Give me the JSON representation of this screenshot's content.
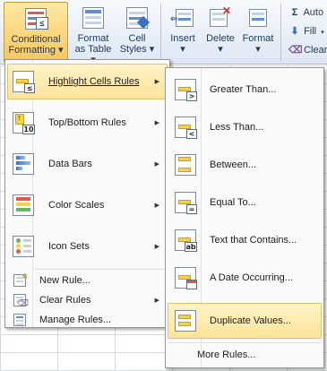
{
  "ribbon": {
    "conditional_formatting": {
      "line1": "Conditional",
      "line2": "Formatting",
      "icon": "conditional-formatting-icon"
    },
    "format_as_table": {
      "line1": "Format",
      "line2": "as Table",
      "icon": "format-as-table-icon"
    },
    "cell_styles": {
      "line1": "Cell",
      "line2": "Styles",
      "icon": "cell-styles-icon"
    },
    "insert": {
      "label": "Insert",
      "icon": "insert-cells-icon"
    },
    "delete": {
      "label": "Delete",
      "icon": "delete-cells-icon"
    },
    "format": {
      "label": "Format",
      "icon": "format-cells-icon"
    },
    "autosum": {
      "glyph": "Σ",
      "label": "Auto"
    },
    "fill": {
      "glyph": "⬇",
      "label": "Fill"
    },
    "clear": {
      "glyph": "⌫",
      "label": "Clear"
    },
    "dropdown_glyph": "▾"
  },
  "main_menu": {
    "items": [
      {
        "label": "Highlight Cells Rules",
        "hotkey_index": 0,
        "icon": "highlight-cells-rules-icon",
        "submenu": true,
        "highlighted": true
      },
      {
        "label": "Top/Bottom Rules",
        "icon": "top-bottom-rules-icon",
        "submenu": true
      },
      {
        "label": "Data Bars",
        "icon": "data-bars-icon",
        "submenu": true
      },
      {
        "label": "Color Scales",
        "icon": "color-scales-icon",
        "submenu": true
      },
      {
        "label": "Icon Sets",
        "icon": "icon-sets-icon",
        "submenu": true
      },
      {
        "label": "New Rule...",
        "icon": "new-rule-icon",
        "submenu": false
      },
      {
        "label": "Clear Rules",
        "icon": "clear-rules-icon",
        "submenu": true
      },
      {
        "label": "Manage Rules...",
        "icon": "manage-rules-icon",
        "submenu": false
      }
    ],
    "submenu_glyph": "▶"
  },
  "sub_menu": {
    "items": [
      {
        "label": "Greater Than...",
        "icon": "greater-than-icon",
        "badge": ">"
      },
      {
        "label": "Less Than...",
        "icon": "less-than-icon",
        "badge": "<"
      },
      {
        "label": "Between...",
        "icon": "between-icon",
        "badge": ""
      },
      {
        "label": "Equal To...",
        "icon": "equal-to-icon",
        "badge": "="
      },
      {
        "label": "Text that Contains...",
        "icon": "text-contains-icon",
        "badge": "ab"
      },
      {
        "label": "A Date Occurring...",
        "icon": "date-occurring-icon",
        "badge": ""
      },
      {
        "label": "Duplicate Values...",
        "icon": "duplicate-values-icon",
        "badge": "",
        "highlighted": true
      },
      {
        "label": "More Rules...",
        "icon": "",
        "badge": ""
      }
    ]
  },
  "colors": {
    "ribbon_text": "#1e395b",
    "highlight": "#fde49a",
    "cell_highlight": "#f6d24a"
  }
}
